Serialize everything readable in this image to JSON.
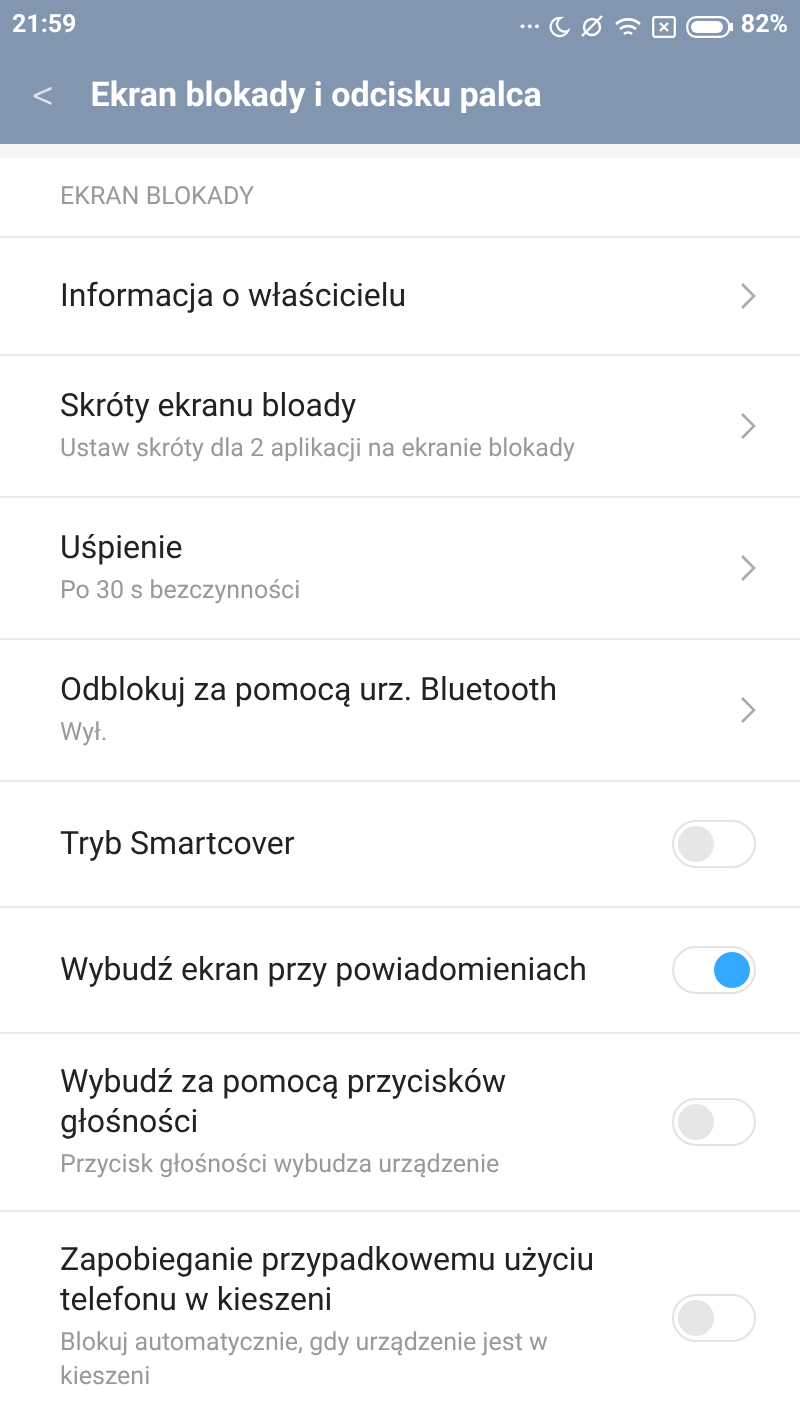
{
  "status_bar": {
    "time": "21:59",
    "dots": "...",
    "battery": "82%"
  },
  "header": {
    "back": "<",
    "title": "Ekran blokady i odcisku palca"
  },
  "section": {
    "title": "EKRAN BLOKADY",
    "rows": [
      {
        "kind": "link",
        "title": "Informacja o właścicielu"
      },
      {
        "kind": "link",
        "title": "Skróty ekranu bloady",
        "subtitle": "Ustaw skróty dla 2 aplikacji na ekranie blokady"
      },
      {
        "kind": "link",
        "title": "Uśpienie",
        "subtitle": "Po 30 s bezczynności"
      },
      {
        "kind": "link",
        "title": "Odblokuj za pomocą urz. Bluetooth",
        "subtitle": "Wył."
      },
      {
        "kind": "switch",
        "title": "Tryb Smartcover",
        "on": false
      },
      {
        "kind": "switch",
        "title": "Wybudź ekran przy powiadomieniach",
        "on": true
      },
      {
        "kind": "switch",
        "title": "Wybudź za pomocą przycisków głośności",
        "subtitle": "Przycisk głośności wybudza urządzenie",
        "on": false
      },
      {
        "kind": "switch",
        "title": "Zapobieganie przypadkowemu użyciu telefonu w kieszeni",
        "subtitle": "Blokuj automatycznie, gdy urządzenie jest w kieszeni",
        "on": false
      }
    ]
  }
}
